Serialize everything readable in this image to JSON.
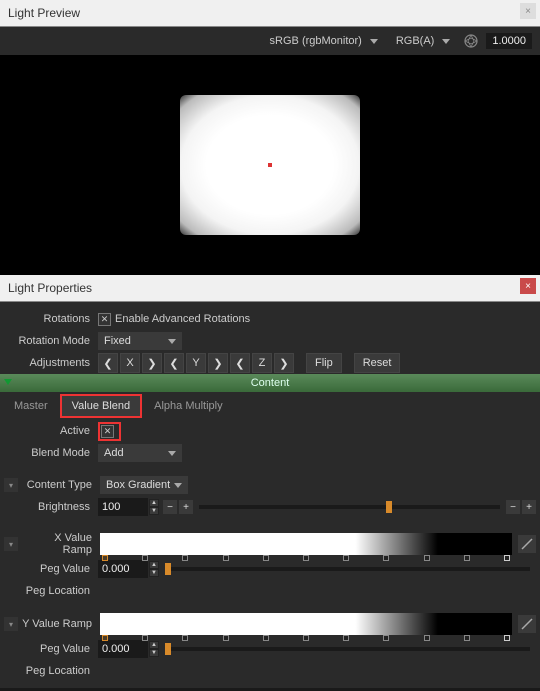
{
  "preview": {
    "title": "Light Preview",
    "colorspace": "sRGB (rgbMonitor)",
    "channels": "RGB(A)",
    "exposure": "1.0000"
  },
  "properties": {
    "title": "Light Properties",
    "rotations_label": "Rotations",
    "enable_adv_rotations": "Enable Advanced Rotations",
    "rotation_mode_label": "Rotation Mode",
    "rotation_mode_value": "Fixed",
    "adjustments_label": "Adjustments",
    "axis_x": "X",
    "axis_y": "Y",
    "axis_z": "Z",
    "flip_label": "Flip",
    "reset_label": "Reset",
    "content_header": "Content",
    "tabs": {
      "master": "Master",
      "value_blend": "Value Blend",
      "alpha_multiply": "Alpha Multiply"
    },
    "active_label": "Active",
    "blend_mode_label": "Blend Mode",
    "blend_mode_value": "Add",
    "content_type_label": "Content Type",
    "content_type_value": "Box Gradient",
    "brightness_label": "Brightness",
    "brightness_value": "100",
    "x_ramp_label": "X Value Ramp",
    "y_ramp_label": "Y Value Ramp",
    "peg_value_label": "Peg Value",
    "peg_value_x": "0.000",
    "peg_value_y": "0.000",
    "peg_location_label": "Peg Location"
  }
}
